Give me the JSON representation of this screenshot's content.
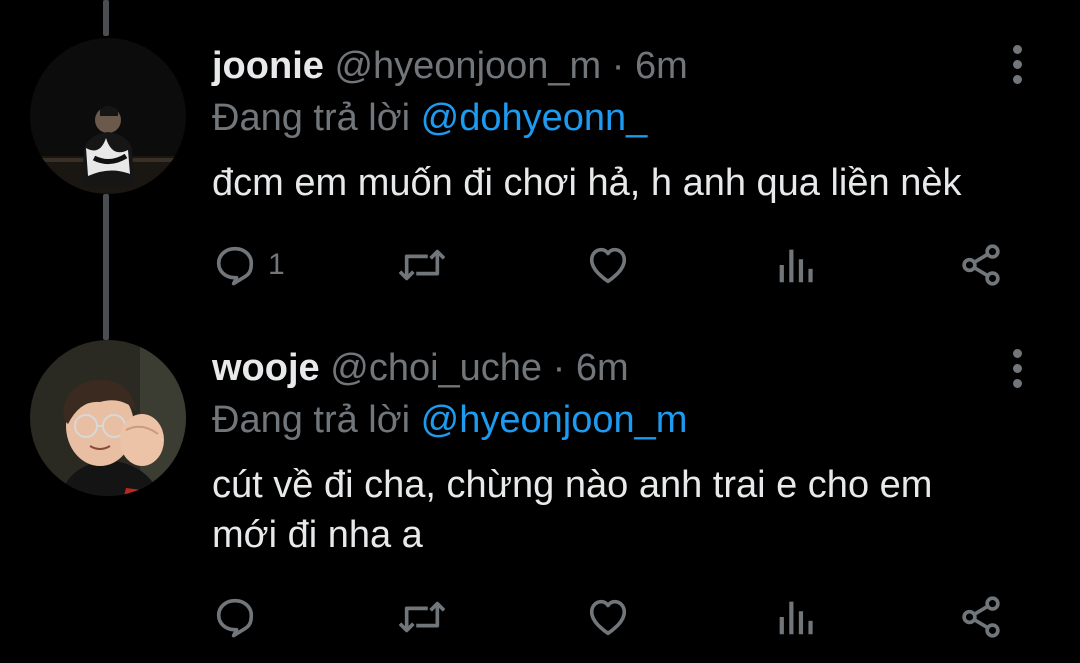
{
  "colors": {
    "background": "#000000",
    "text_primary": "#e7e9ea",
    "text_secondary": "#71767b",
    "mention": "#1d9bf0",
    "thread_line": "#4a4d52"
  },
  "tweets": [
    {
      "display_name": "joonie",
      "handle": "@hyeonjoon_m",
      "separator": "·",
      "time": "6m",
      "reply_prefix": "Đang trả lời",
      "reply_to": "@dohyeonn_",
      "text": "đcm em muốn đi chơi hả, h anh qua liền nèk",
      "reply_count": "1",
      "icons": [
        "reply-icon",
        "retweet-icon",
        "like-icon",
        "analytics-icon",
        "share-icon",
        "more-icon"
      ]
    },
    {
      "display_name": "wooje",
      "handle": "@choi_uche",
      "separator": "·",
      "time": "6m",
      "reply_prefix": "Đang trả lời",
      "reply_to": "@hyeonjoon_m",
      "text_line1": "cút về đi cha, chừng nào anh trai e cho em",
      "text_line2": "mới đi nha a",
      "reply_count": "",
      "icons": [
        "reply-icon",
        "retweet-icon",
        "like-icon",
        "analytics-icon",
        "share-icon",
        "more-icon"
      ]
    }
  ]
}
